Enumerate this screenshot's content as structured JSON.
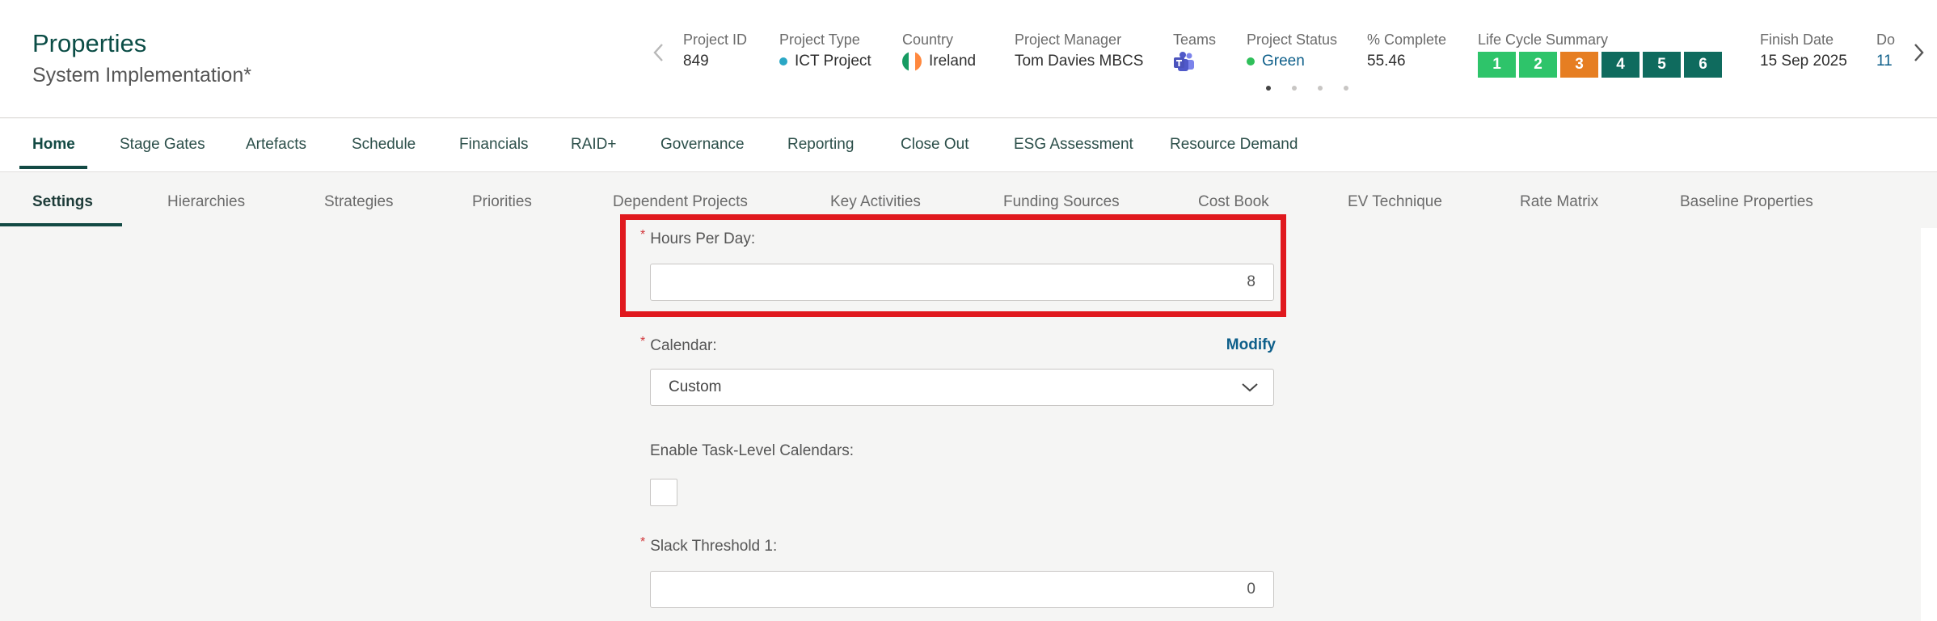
{
  "header": {
    "title": "Properties",
    "subtitle": "System Implementation*",
    "prev_icon": "chevron-left-icon",
    "next_icon": "chevron-right-icon",
    "kpis": {
      "project_id": {
        "label": "Project ID",
        "value": "849"
      },
      "project_type": {
        "label": "Project Type",
        "value": "ICT Project",
        "dot_color": "#2aa7c5"
      },
      "country": {
        "label": "Country",
        "value": "Ireland",
        "flag_colors": [
          "#169b62",
          "#ffffff",
          "#ff883e"
        ]
      },
      "project_manager": {
        "label": "Project Manager",
        "value": "Tom Davies MBCS"
      },
      "teams": {
        "label": "Teams",
        "icon": "microsoft-teams-icon"
      },
      "project_status": {
        "label": "Project Status",
        "value": "Green",
        "dot_color": "#2fbf5a"
      },
      "percent_complete": {
        "label": "% Complete",
        "value": "55.46"
      },
      "life_cycle": {
        "label": "Life Cycle Summary",
        "stages": [
          {
            "label": "1",
            "color": "#2ec46a"
          },
          {
            "label": "2",
            "color": "#2ec46a"
          },
          {
            "label": "3",
            "color": "#e67e22"
          },
          {
            "label": "4",
            "color": "#0f6b5e"
          },
          {
            "label": "5",
            "color": "#0f6b5e"
          },
          {
            "label": "6",
            "color": "#0f6b5e"
          }
        ]
      },
      "finish_date": {
        "label": "Finish Date",
        "value": "15 Sep 2025"
      },
      "do": {
        "label": "Do",
        "value": "11"
      }
    },
    "pager": {
      "count": 4,
      "active_index": 0
    }
  },
  "main_tabs": [
    {
      "label": "Home",
      "active": true
    },
    {
      "label": "Stage Gates"
    },
    {
      "label": "Artefacts"
    },
    {
      "label": "Schedule"
    },
    {
      "label": "Financials"
    },
    {
      "label": "RAID+"
    },
    {
      "label": "Governance"
    },
    {
      "label": "Reporting"
    },
    {
      "label": "Close Out"
    },
    {
      "label": "ESG Assessment"
    },
    {
      "label": "Resource Demand"
    }
  ],
  "sub_tabs": [
    {
      "label": "Settings",
      "active": true
    },
    {
      "label": "Hierarchies"
    },
    {
      "label": "Strategies"
    },
    {
      "label": "Priorities"
    },
    {
      "label": "Dependent Projects"
    },
    {
      "label": "Key Activities"
    },
    {
      "label": "Funding Sources"
    },
    {
      "label": "Cost Book"
    },
    {
      "label": "EV Technique"
    },
    {
      "label": "Rate Matrix"
    },
    {
      "label": "Baseline Properties"
    }
  ],
  "form": {
    "required_mark": "*",
    "hours_per_day": {
      "label": "Hours Per Day:",
      "value": "8"
    },
    "calendar": {
      "label": "Calendar:",
      "value": "Custom",
      "modify_label": "Modify",
      "dropdown_icon": "chevron-down-icon"
    },
    "task_level_calendars": {
      "label": "Enable Task-Level Calendars:",
      "checked": false
    },
    "slack_threshold_1": {
      "label": "Slack Threshold 1:",
      "value": "0"
    }
  },
  "colors": {
    "brand_teal": "#134a44",
    "link_blue": "#0e5f8a",
    "highlight_red": "#e0191e"
  }
}
